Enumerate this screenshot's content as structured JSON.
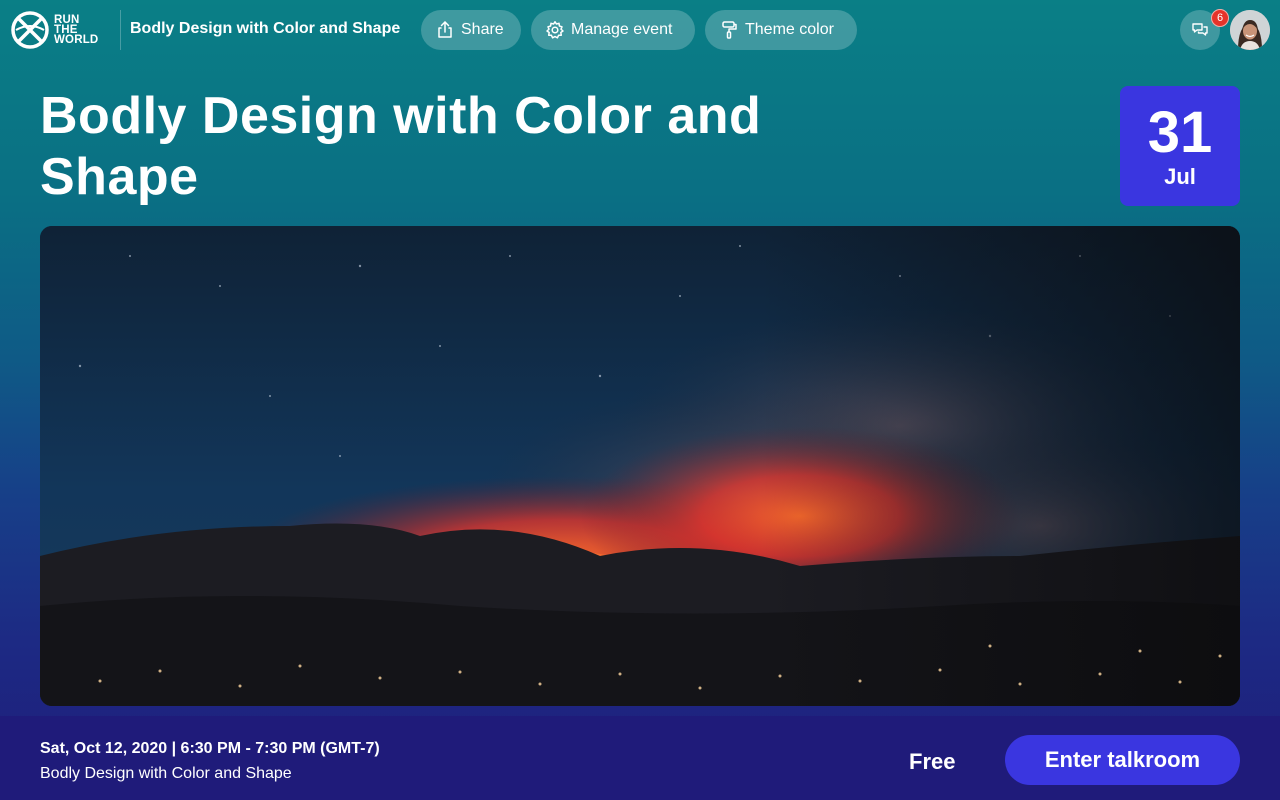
{
  "header": {
    "logo_lines": [
      "RUN",
      "THE",
      "WORLD"
    ],
    "event_name": "Bodly Design with Color and Shape",
    "actions": [
      {
        "label": "Share",
        "icon": "share-icon"
      },
      {
        "label": "Manage event",
        "icon": "gear-icon"
      },
      {
        "label": "Theme color",
        "icon": "paint-roller-icon"
      }
    ],
    "chat": {
      "icon": "chat-icon",
      "notification_count": "6"
    },
    "avatar": {
      "icon": "user-avatar"
    }
  },
  "event": {
    "title": "Bodly Design with Color and Shape",
    "date_day": "31",
    "date_month": "Jul",
    "hero_image": "night wildfire over mountains"
  },
  "footer": {
    "datetime": "Sat, Oct 12, 2020 | 6:30 PM - 7:30 PM (GMT-7)",
    "event_name": "Bodly Design with Color and Shape",
    "price": "Free",
    "cta_label": "Enter talkroom"
  },
  "colors": {
    "accent": "#3a36e0",
    "bg_top": "#0a7f86",
    "bg_bottom": "#1e1c7a",
    "badge": "#e5332a"
  }
}
